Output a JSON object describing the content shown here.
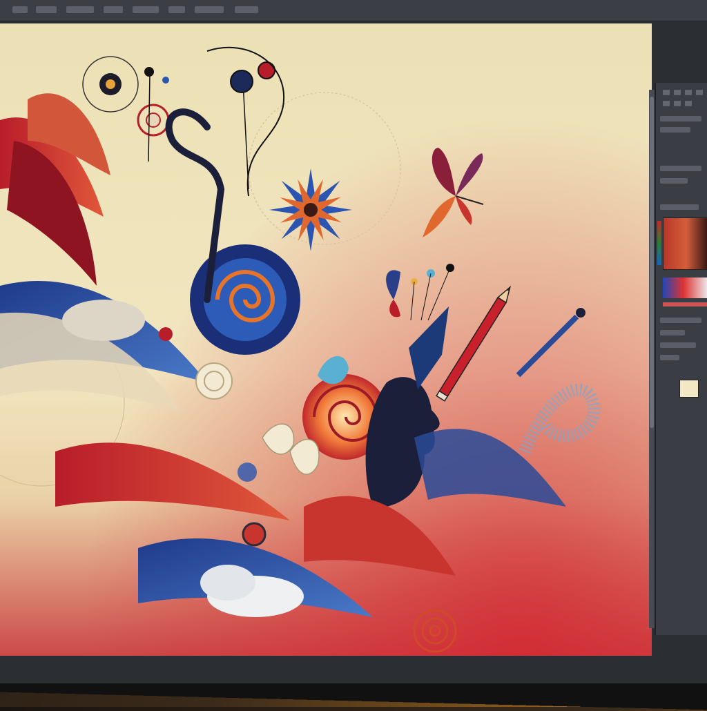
{
  "app": {
    "menu_items": [
      "",
      "",
      "",
      "",
      "",
      "",
      "",
      ""
    ]
  },
  "canvas": {
    "background_top": "#ece0b6",
    "background_bottom": "#cc4a48"
  },
  "panel": {
    "fill_color": "#f3e8c6",
    "picker_base": "#b8372a"
  },
  "icons": [
    "butterfly-icon",
    "pencil-icon",
    "brush-icon",
    "flower-icon",
    "spiral-icon",
    "face-silhouette-icon"
  ]
}
